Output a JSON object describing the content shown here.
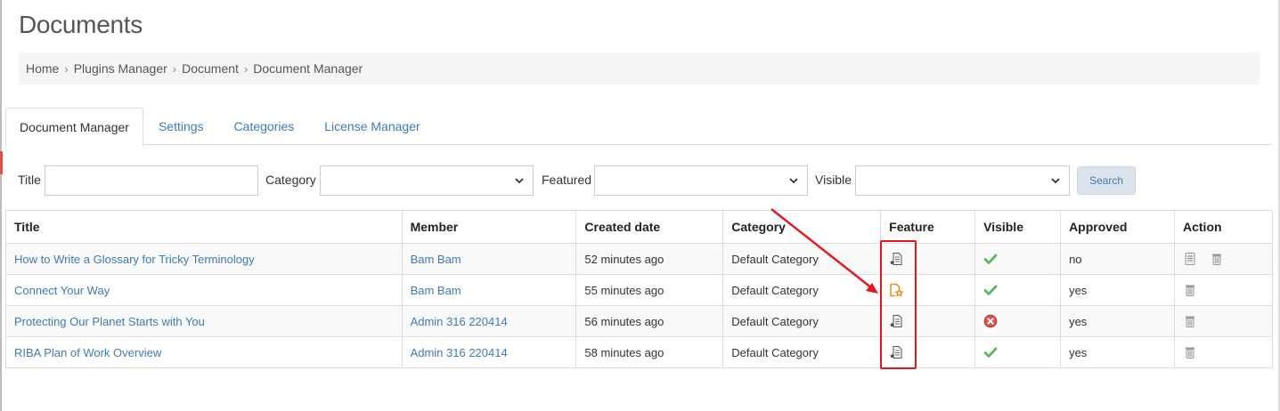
{
  "page": {
    "title": "Documents"
  },
  "breadcrumb": [
    "Home",
    "Plugins Manager",
    "Document",
    "Document Manager"
  ],
  "tabs": [
    {
      "label": "Document Manager",
      "active": true
    },
    {
      "label": "Settings",
      "active": false
    },
    {
      "label": "Categories",
      "active": false
    },
    {
      "label": "License Manager",
      "active": false
    }
  ],
  "filters": {
    "title_label": "Title",
    "title_value": "",
    "category_label": "Category",
    "category_value": "",
    "featured_label": "Featured",
    "featured_value": "",
    "visible_label": "Visible",
    "visible_value": "",
    "search_label": "Search"
  },
  "table": {
    "headers": [
      "Title",
      "Member",
      "Created date",
      "Category",
      "Feature",
      "Visible",
      "Approved",
      "Action"
    ],
    "rows": [
      {
        "title": "How to Write a Glossary for Tricky Terminology",
        "member": "Bam Bam",
        "created": "52 minutes ago",
        "category": "Default Category",
        "featured": false,
        "visible": true,
        "approved": "no",
        "actions": [
          "view-icon",
          "trash-icon"
        ]
      },
      {
        "title": "Connect Your Way",
        "member": "Bam Bam",
        "created": "55 minutes ago",
        "category": "Default Category",
        "featured": true,
        "visible": true,
        "approved": "yes",
        "actions": [
          "trash-icon"
        ]
      },
      {
        "title": "Protecting Our Planet Starts with You",
        "member": "Admin 316 220414",
        "created": "56 minutes ago",
        "category": "Default Category",
        "featured": false,
        "visible": false,
        "approved": "yes",
        "actions": [
          "trash-icon"
        ]
      },
      {
        "title": "RIBA Plan of Work Overview",
        "member": "Admin 316 220414",
        "created": "58 minutes ago",
        "category": "Default Category",
        "featured": false,
        "visible": true,
        "approved": "yes",
        "actions": [
          "trash-icon"
        ]
      }
    ]
  },
  "colors": {
    "link": "#3c7bb8",
    "check": "#5cb85c",
    "error": "#d9534f",
    "featured": "#f0841e",
    "annotation": "#e8141c"
  }
}
